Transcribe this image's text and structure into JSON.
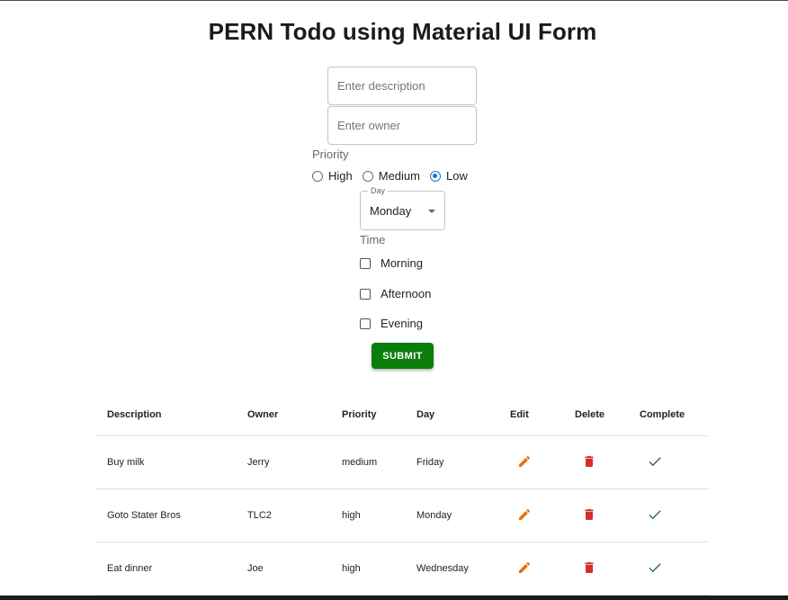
{
  "page": {
    "title": "PERN Todo using Material UI Form"
  },
  "form": {
    "description_placeholder": "Enter description",
    "owner_placeholder": "Enter owner",
    "priority_label": "Priority",
    "priority_options": [
      {
        "label": "High",
        "selected": false
      },
      {
        "label": "Medium",
        "selected": false
      },
      {
        "label": "Low",
        "selected": true
      }
    ],
    "day_label": "Day",
    "day_value": "Monday",
    "time_label": "Time",
    "time_options": [
      {
        "label": "Morning",
        "checked": false
      },
      {
        "label": "Afternoon",
        "checked": false
      },
      {
        "label": "Evening",
        "checked": false
      }
    ],
    "submit_label": "SUBMIT"
  },
  "table": {
    "headers": [
      "Description",
      "Owner",
      "Priority",
      "Day",
      "Edit",
      "Delete",
      "Complete"
    ],
    "rows": [
      {
        "description": "Buy milk",
        "owner": "Jerry",
        "priority": "medium",
        "day": "Friday"
      },
      {
        "description": "Goto Stater Bros",
        "owner": "TLC2",
        "priority": "high",
        "day": "Monday"
      },
      {
        "description": "Eat dinner",
        "owner": "Joe",
        "priority": "high",
        "day": "Wednesday"
      }
    ]
  },
  "icons": {
    "edit": "pencil-icon",
    "delete": "trash-icon",
    "complete": "check-icon"
  },
  "colors": {
    "submit": "#0a7d0a",
    "edit_icon": "#ef6c00",
    "delete_icon": "#d32f2f",
    "complete_icon": "#2e7d32",
    "radio_selected": "#1976d2"
  }
}
